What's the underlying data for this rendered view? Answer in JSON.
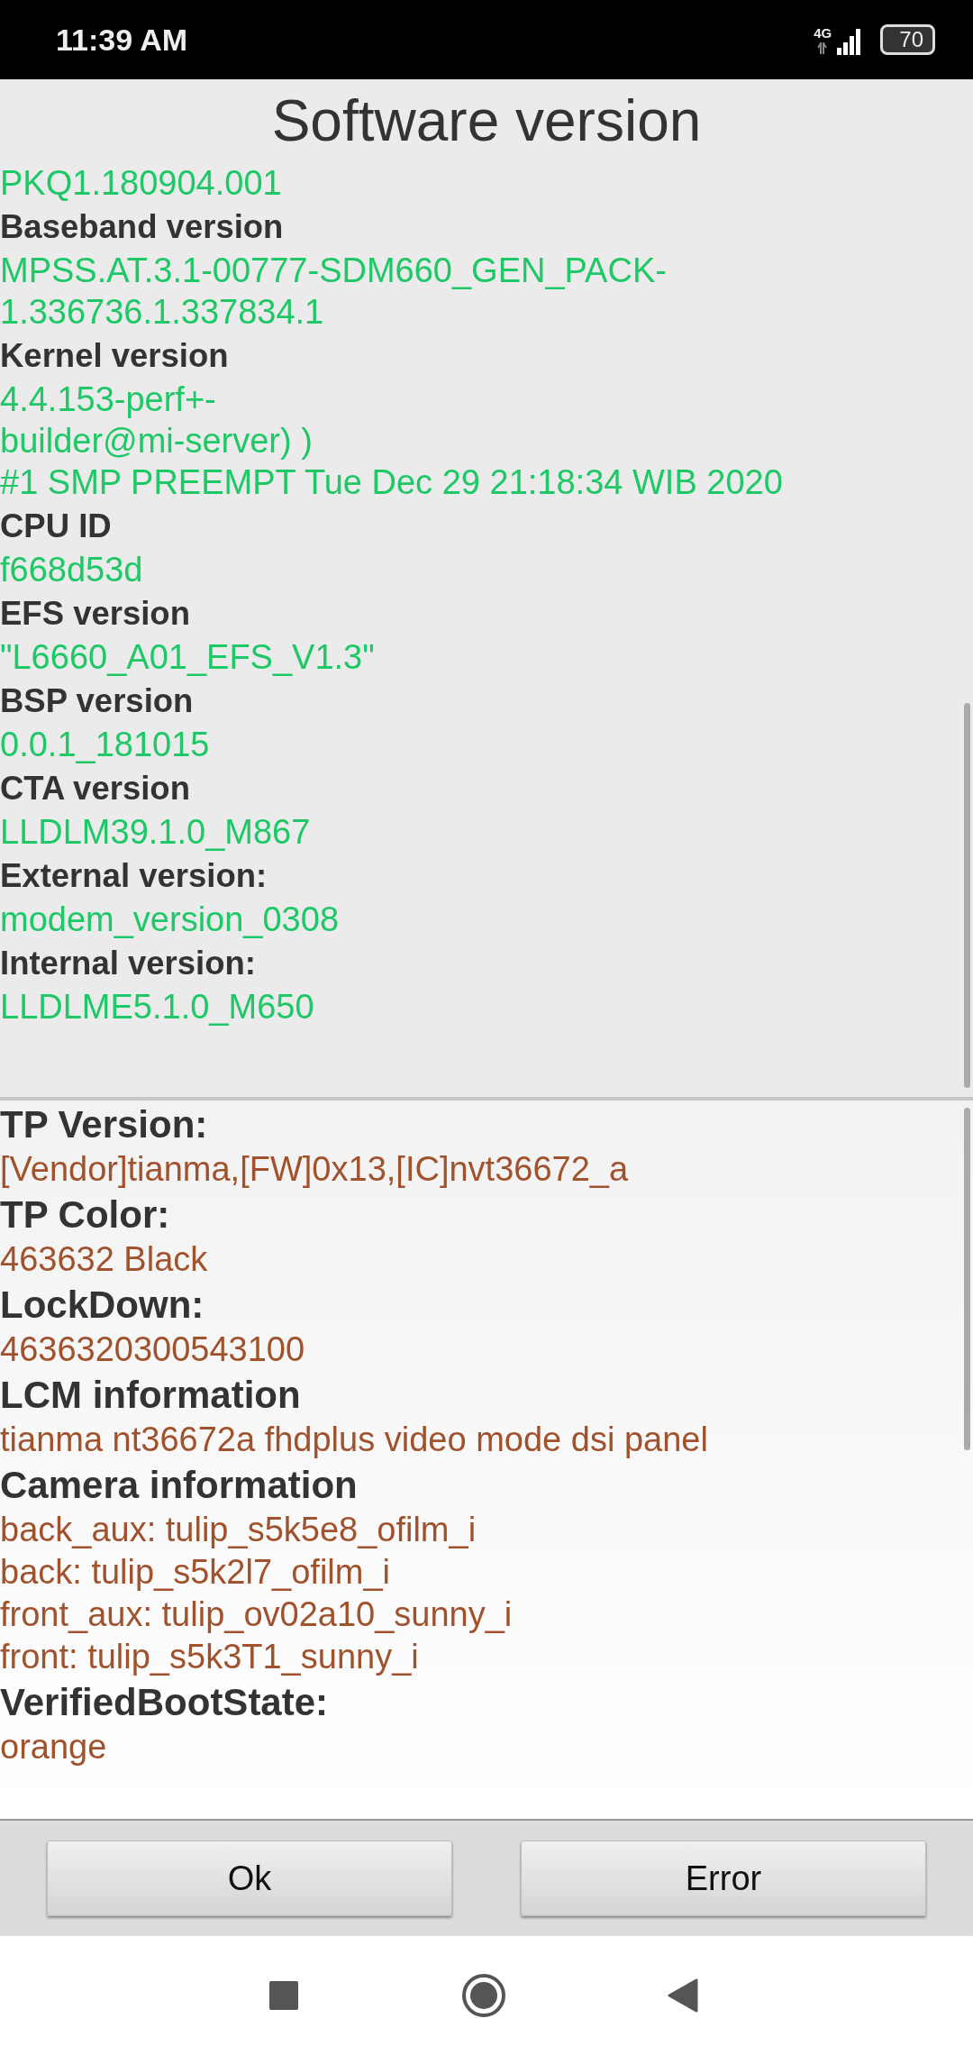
{
  "status_bar": {
    "time": "11:39 AM",
    "network": "4G",
    "battery": "70"
  },
  "title": "Software version",
  "sections": [
    {
      "kind": "software",
      "lines": [
        {
          "kind": "value",
          "text": "PKQ1.180904.001"
        },
        {
          "kind": "label",
          "text": "Baseband version"
        },
        {
          "kind": "value",
          "text": "MPSS.AT.3.1-00777-SDM660_GEN_PACK-1.336736.1.337834.1"
        },
        {
          "kind": "label",
          "text": "Kernel version"
        },
        {
          "kind": "value",
          "text": "4.4.153-perf+-"
        },
        {
          "kind": "value",
          "text": "builder@mi-server) )"
        },
        {
          "kind": "value",
          "text": "#1 SMP PREEMPT Tue Dec 29 21:18:34 WIB 2020"
        },
        {
          "kind": "label",
          "text": "CPU ID"
        },
        {
          "kind": "value",
          "text": "f668d53d"
        },
        {
          "kind": "label",
          "text": "EFS version"
        },
        {
          "kind": "value",
          "text": "\"L6660_A01_EFS_V1.3\""
        },
        {
          "kind": "label",
          "text": "BSP version"
        },
        {
          "kind": "value",
          "text": "0.0.1_181015"
        },
        {
          "kind": "label",
          "text": "CTA version"
        },
        {
          "kind": "value",
          "text": "LLDLM39.1.0_M867"
        },
        {
          "kind": "label",
          "text": "External version:"
        },
        {
          "kind": "value",
          "text": "modem_version_0308"
        },
        {
          "kind": "label",
          "text": "Internal version:"
        },
        {
          "kind": "value",
          "text": "LLDLME5.1.0_M650"
        }
      ]
    },
    {
      "kind": "hardware",
      "lines": [
        {
          "kind": "label",
          "text": "TP Version:"
        },
        {
          "kind": "value",
          "text": "[Vendor]tianma,[FW]0x13,[IC]nvt36672_a"
        },
        {
          "kind": "label",
          "text": "TP Color:"
        },
        {
          "kind": "value",
          "text": "463632 Black"
        },
        {
          "kind": "label",
          "text": "LockDown:"
        },
        {
          "kind": "value",
          "text": "4636320300543100"
        },
        {
          "kind": "label",
          "text": "LCM information"
        },
        {
          "kind": "value",
          "text": "tianma nt36672a fhdplus video mode dsi panel"
        },
        {
          "kind": "label",
          "text": "Camera information"
        },
        {
          "kind": "value",
          "text": "back_aux: tulip_s5k5e8_ofilm_i"
        },
        {
          "kind": "value",
          "text": "back: tulip_s5k2l7_ofilm_i"
        },
        {
          "kind": "value",
          "text": "front_aux: tulip_ov02a10_sunny_i"
        },
        {
          "kind": "value",
          "text": "front: tulip_s5k3T1_sunny_i"
        },
        {
          "kind": "label",
          "text": "VerifiedBootState:"
        },
        {
          "kind": "value",
          "text": "orange"
        }
      ]
    }
  ],
  "buttons": [
    "Ok",
    "Error"
  ]
}
